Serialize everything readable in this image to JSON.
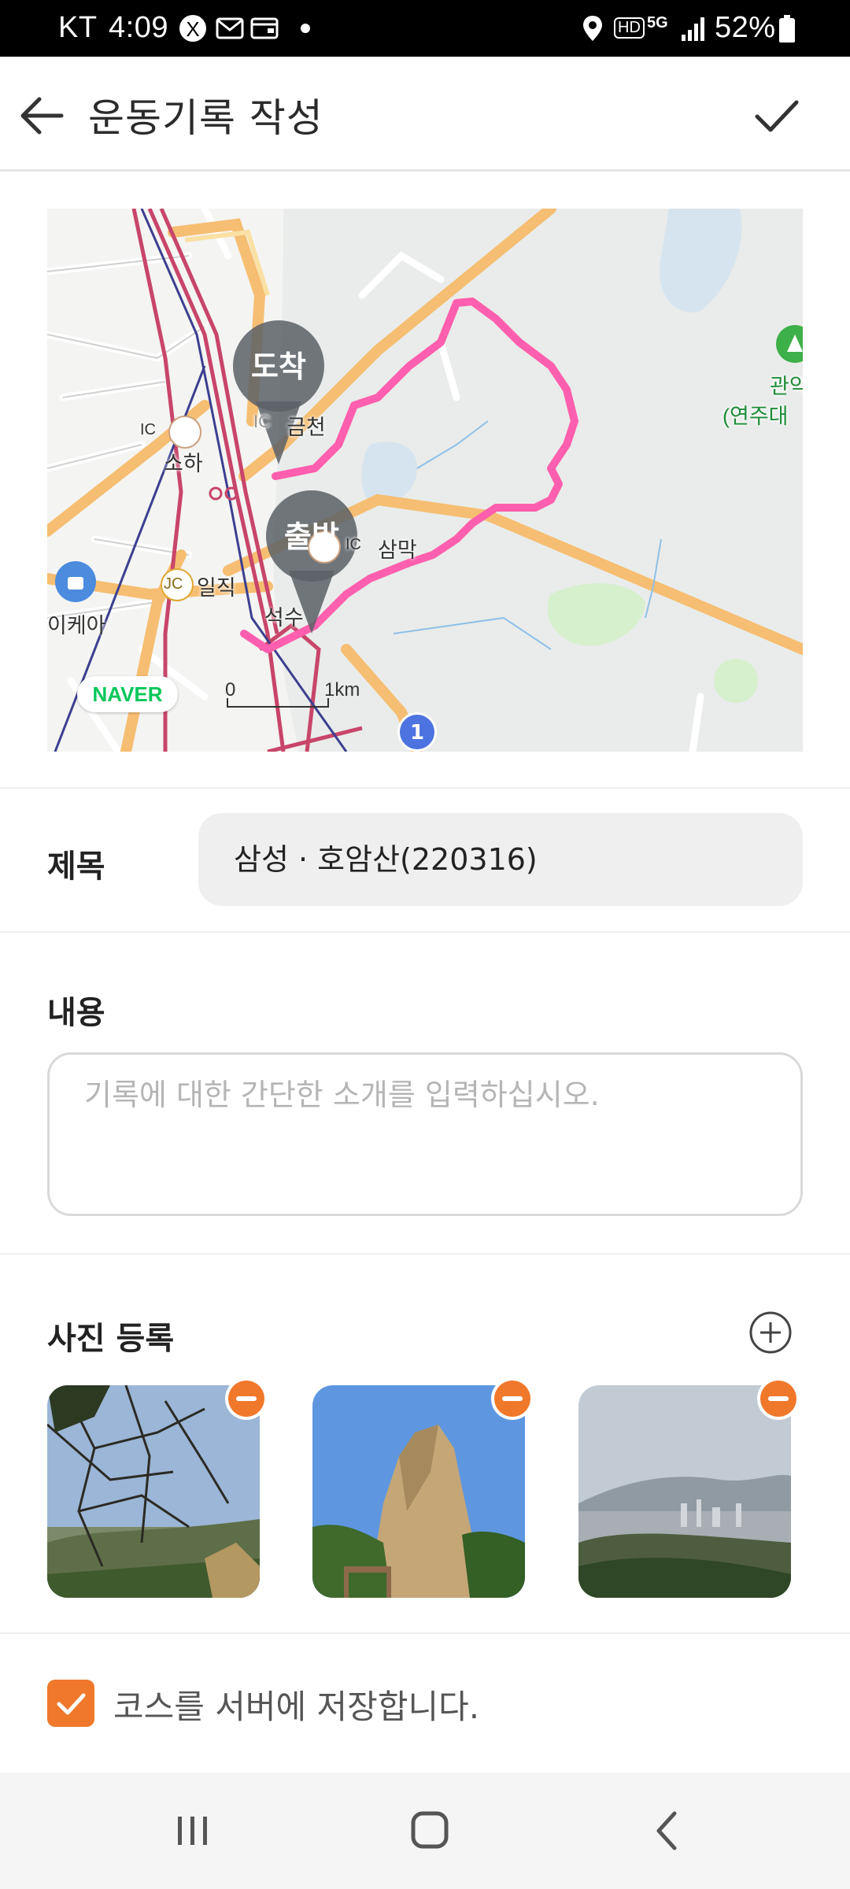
{
  "status_bar": {
    "carrier": "KT",
    "time": "4:09",
    "hd_label": "HD",
    "network": "5G",
    "battery": "52%"
  },
  "app_bar": {
    "title": "운동기록 작성"
  },
  "map": {
    "labels": {
      "ic_top": "IC",
      "geumcheon": "금천",
      "soha": "소하",
      "sammak": "삼막",
      "jc": "JC",
      "iljik": "일직",
      "seoksu": "석수",
      "ikea": "이케아",
      "gwanak": "관악",
      "yeonju": "(연주대",
      "ic_soha": "IC",
      "ic_sammak": "IC"
    },
    "pins": {
      "end": "도착",
      "start": "출발"
    },
    "naver_logo": "NAVER",
    "scale_zero": "0",
    "scale_one": "1km",
    "route_badge": "1",
    "colors": {
      "route": "#ff5fae",
      "major_road": "#f6be72",
      "rail": "#c8456a"
    }
  },
  "form": {
    "title_label": "제목",
    "title_value": "삼성 · 호암산(220316)",
    "content_label": "내용",
    "content_placeholder": "기록에 대한 간단한 소개를 입력하십시오.",
    "photo_label": "사진 등록",
    "photos": [
      {
        "name": "photo-tree-branches"
      },
      {
        "name": "photo-rock-peak"
      },
      {
        "name": "photo-city-view"
      }
    ],
    "save_course_label": "코스를 서버에 저장합니다.",
    "save_course_checked": true
  },
  "theme": {
    "accent": "#f0782b"
  },
  "nav_bar": {
    "icons": [
      "recent-apps-icon",
      "home-icon",
      "back-icon"
    ]
  }
}
